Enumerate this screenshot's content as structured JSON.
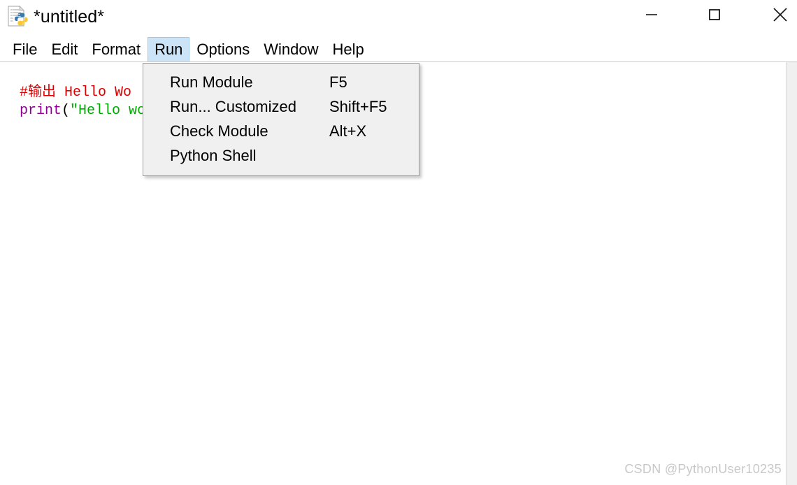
{
  "window": {
    "title": "*untitled*",
    "icon": "python-file-icon",
    "controls": [
      {
        "name": "minimize-button",
        "glyph": "minimize-icon",
        "label": "Minimize"
      },
      {
        "name": "maximize-button",
        "glyph": "maximize-icon",
        "label": "Maximize"
      },
      {
        "name": "close-button",
        "glyph": "close-icon",
        "label": "Close"
      }
    ]
  },
  "menubar": {
    "items": [
      {
        "label": "File",
        "active": false
      },
      {
        "label": "Edit",
        "active": false
      },
      {
        "label": "Format",
        "active": false
      },
      {
        "label": "Run",
        "active": true
      },
      {
        "label": "Options",
        "active": false
      },
      {
        "label": "Window",
        "active": false
      },
      {
        "label": "Help",
        "active": false
      }
    ],
    "active_index": 3,
    "highlight_color": "#cce4f7",
    "highlight_border_color": "#9ec9ea"
  },
  "run_menu": {
    "open": true,
    "items": [
      {
        "label": "Run Module",
        "accel": "F5"
      },
      {
        "label": "Run... Customized",
        "accel": "Shift+F5"
      },
      {
        "label": "Check Module",
        "accel": "Alt+X"
      },
      {
        "label": "Python Shell",
        "accel": ""
      }
    ],
    "background": "#f0f0f0",
    "border_color": "#a0a0a0"
  },
  "editor": {
    "lines": [
      {
        "tokens": [
          {
            "text": "#输出 Hello Wo",
            "type": "comment"
          }
        ]
      },
      {
        "tokens": [
          {
            "text": "print",
            "type": "builtin"
          },
          {
            "text": "(",
            "type": "punct"
          },
          {
            "text": "\"Hello wo",
            "type": "string"
          }
        ]
      }
    ],
    "colors": {
      "comment": "#dd0000",
      "builtin": "#900090",
      "string": "#00aa00",
      "punct": "#000000",
      "background": "#ffffff"
    }
  },
  "watermark": {
    "text": "CSDN @PythonUser10235"
  }
}
